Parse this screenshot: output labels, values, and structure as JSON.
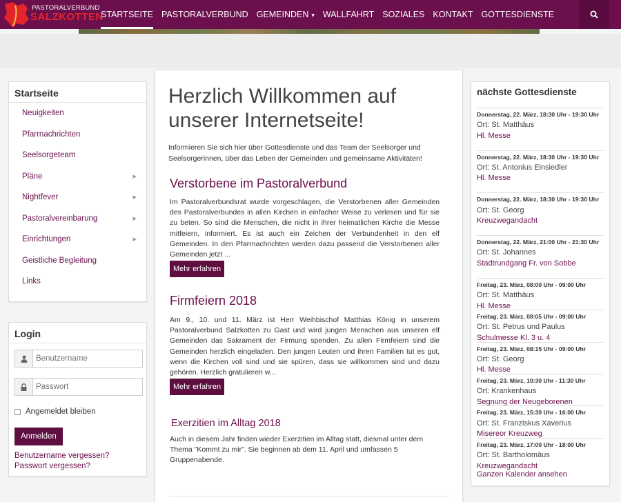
{
  "brand": {
    "line1": "PASTORALVERBUND",
    "line2": "SALZKOTTEN",
    "accent": "#6b0f4d",
    "logo_red": "#e3242b"
  },
  "nav": {
    "items": [
      {
        "label": "STARTSEITE"
      },
      {
        "label": "PASTORALVERBUND"
      },
      {
        "label": "GEMEINDEN",
        "caret": "▾"
      },
      {
        "label": "WALLFAHRT"
      },
      {
        "label": "SOZIALES"
      },
      {
        "label": "KONTAKT"
      },
      {
        "label": "GOTTESDIENSTE"
      }
    ],
    "active": "STARTSEITE",
    "search_icon": "search-icon"
  },
  "sidebar": {
    "title": "Startseite",
    "items": [
      {
        "label": "Neuigkeiten",
        "has_children": false
      },
      {
        "label": "Pfarrnachrichten",
        "has_children": false
      },
      {
        "label": "Seelsorgeteam",
        "has_children": false
      },
      {
        "label": "Pläne",
        "has_children": true
      },
      {
        "label": "Nightfever",
        "has_children": true
      },
      {
        "label": "Pastoralvereinbarung",
        "has_children": true
      },
      {
        "label": "Einrichtungen",
        "has_children": true
      },
      {
        "label": "Geistliche Begleitung",
        "has_children": false
      },
      {
        "label": "Links",
        "has_children": false
      }
    ]
  },
  "login": {
    "title": "Login",
    "username_placeholder": "Benutzername",
    "password_placeholder": "Passwort",
    "remember_label": "Angemeldet bleiben",
    "submit_label": "Anmelden",
    "forgot_username": "Benutzername vergessen?",
    "forgot_password": "Passwort vergessen?"
  },
  "main": {
    "welcome": "Herzlich Willkommen auf unserer Internetseite!",
    "intro": "Informieren Sie sich hier über Gottesdienste und das Team der Seelsorger und Seelsorgerinnen, über das Leben der Gemeinden und gemeinsame Aktivitäten!",
    "articles": [
      {
        "title": "Verstorbene im Pastoralverbund",
        "text": "Im Pastoralverbundsrat wurde vorgeschlagen, die Verstorbenen aller Gemeinden des Pastoralverbundes in allen Kirchen in einfacher Weise zu verlesen und für sie zu beten. So sind die Menschen, die nicht in ihrer heimatlichen Kirche die Messe mitfeiern, informiert. Es ist auch ein Zeichen der Verbundenheit in den elf Gemeinden. In den Pfarrnachrichten werden dazu passend die Verstorbenen aller Gemeinden jetzt ...",
        "more": "Mehr erfahren"
      },
      {
        "title": "Firmfeiern 2018",
        "text": "Am 9., 10. und 11. März ist Herr Weihbischof Matthias König in unserem Pastoralverbund Salzkotten zu Gast und wird jungen Menschen aus unseren elf Gemeinden das Sakrament der Firmung spenden. Zu allen Firmfeiern sind die Gemeinden herzlich eingeladen. Den jungen Leuten und ihren Familien tut es gut, wenn die Kirchen voll sind und sie spüren, dass sie willkommen sind und dazu gehören. Herzlich gratulieren w...",
        "more": "Mehr erfahren"
      },
      {
        "title": "Exerzitien im Alltag 2018",
        "text": "Auch in diesem Jahr finden wieder Exerzitien im Alltag statt, diesmal unter dem Thema \"Kommt zu mir\". Sie beginnen ab dem 11. April  und umfassen 5 Gruppenabende."
      }
    ]
  },
  "services": {
    "title": "nächste Gottesdienste",
    "events": [
      {
        "date": "Donnerstag, 22. März, 18:30 Uhr - 19:30 Uhr",
        "place": "Ort: St. Matthäus",
        "type": "Hl. Messe"
      },
      {
        "date": "Donnerstag, 22. März, 18:30 Uhr - 19:30 Uhr",
        "place": "Ort: St. Antonius Einsiedler",
        "type": "Hl. Messe"
      },
      {
        "date": "Donnerstag, 22. März, 18:30 Uhr - 19:30 Uhr",
        "place": "Ort: St. Georg",
        "type": "Kreuzwegandacht"
      },
      {
        "date": "Donnerstag, 22. März, 21:00 Uhr - 21:30 Uhr",
        "place": "Ort: St. Johannes",
        "type": "Stadtrundgang Fr. von Sobbe"
      },
      {
        "date": "Freitag, 23. März, 08:00 Uhr - 09:00 Uhr",
        "place": "Ort: St. Matthäus",
        "type": "Hl. Messe"
      },
      {
        "date": "Freitag, 23. März, 08:05 Uhr - 09:00 Uhr",
        "place": "Ort: St. Petrus und Paulus",
        "type": "Schulmesse Kl. 3 u. 4"
      },
      {
        "date": "Freitag, 23. März, 08:15 Uhr - 09:00 Uhr",
        "place": "Ort: St. Georg",
        "type": "Hl. Messe"
      },
      {
        "date": "Freitag, 23. März, 10:30 Uhr - 11:30 Uhr",
        "place": "Ort: Krankenhaus",
        "type": "Segnung der Neugeborenen"
      },
      {
        "date": "Freitag, 23. März, 15:30 Uhr - 16:00 Uhr",
        "place": "Ort: St. Franziskus Xaverius",
        "type": "Misereor Kreuzweg"
      },
      {
        "date": "Freitag, 23. März, 17:00 Uhr - 18:00 Uhr",
        "place": "Ort: St. Bartholomäus",
        "type": "Kreuzwegandacht"
      }
    ],
    "all_link": "Ganzen Kalender ansehen"
  }
}
